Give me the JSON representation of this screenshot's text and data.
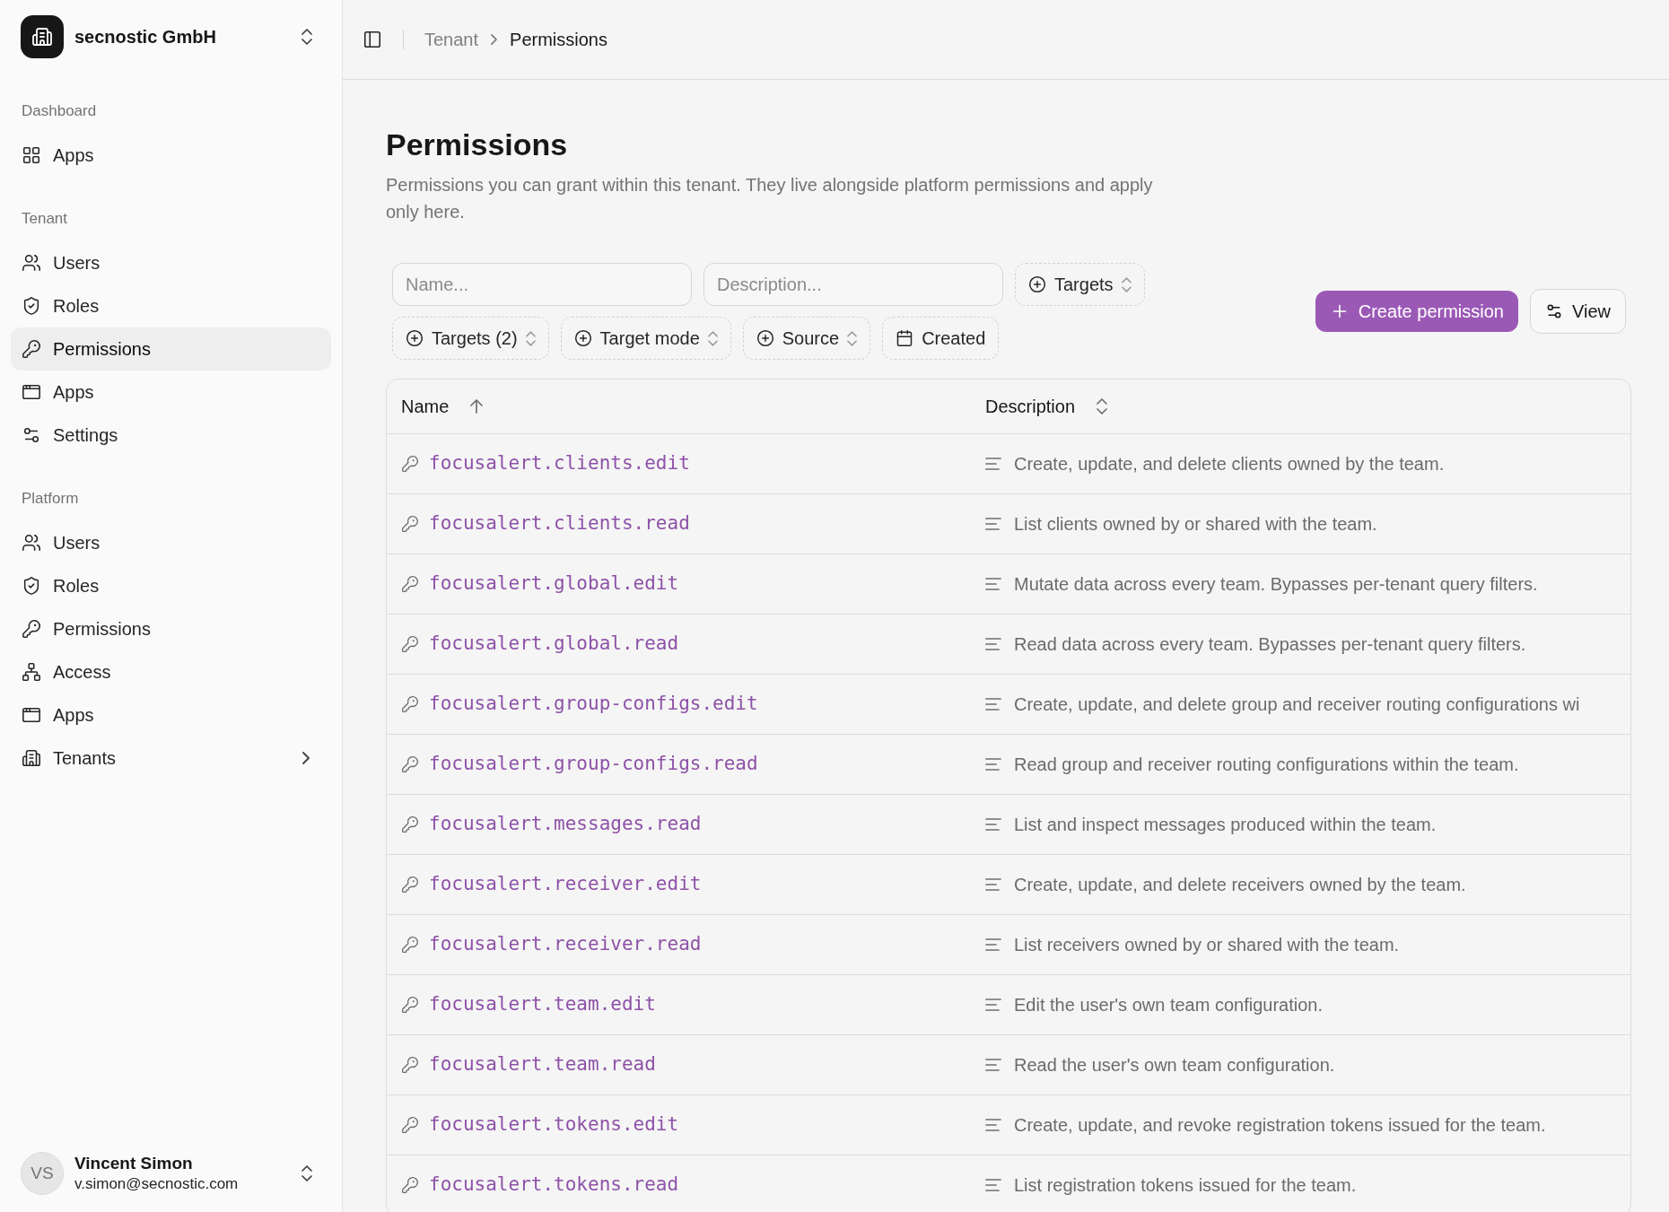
{
  "sidebar": {
    "team": {
      "name": "secnostic GmbH"
    },
    "groups": [
      {
        "label": "Dashboard",
        "items": [
          {
            "label": "Apps",
            "selected": false
          }
        ]
      },
      {
        "label": "Tenant",
        "items": [
          {
            "label": "Users",
            "selected": false
          },
          {
            "label": "Roles",
            "selected": false
          },
          {
            "label": "Permissions",
            "selected": true
          },
          {
            "label": "Apps",
            "selected": false
          },
          {
            "label": "Settings",
            "selected": false
          }
        ]
      },
      {
        "label": "Platform",
        "items": [
          {
            "label": "Users",
            "selected": false
          },
          {
            "label": "Roles",
            "selected": false
          },
          {
            "label": "Permissions",
            "selected": false
          },
          {
            "label": "Access",
            "selected": false
          },
          {
            "label": "Apps",
            "selected": false
          },
          {
            "label": "Tenants",
            "selected": false,
            "expanded": false
          }
        ]
      }
    ],
    "user": {
      "initials": "VS",
      "name": "Vincent Simon",
      "email": "v.simon@secnostic.com"
    }
  },
  "header": {
    "breadcrumb": [
      {
        "label": "Tenant",
        "current": false
      },
      {
        "label": "Permissions",
        "current": true
      }
    ]
  },
  "page": {
    "title": "Permissions",
    "description": "Permissions you can grant within this tenant. They live alongside platform permissions and apply only here."
  },
  "filters": {
    "inputs": [
      {
        "placeholder": "Name..."
      },
      {
        "placeholder": "Description..."
      }
    ],
    "facets": [
      {
        "kind": "select",
        "label": "Targets"
      },
      {
        "kind": "select",
        "label": "Targets (2)"
      },
      {
        "kind": "select",
        "label": "Target mode"
      },
      {
        "kind": "select",
        "label": "Source"
      },
      {
        "kind": "date",
        "label": "Created"
      }
    ]
  },
  "actions": [
    {
      "kind": "primary",
      "label": "Create permission"
    },
    {
      "kind": "view",
      "label": "View"
    }
  ],
  "table": {
    "columns": [
      {
        "label": "Name",
        "sorted": true
      },
      {
        "label": "Description",
        "sorted": false
      }
    ],
    "rows": [
      {
        "name": "focusalert.clients.edit",
        "description": "Create, update, and delete clients owned by the team."
      },
      {
        "name": "focusalert.clients.read",
        "description": "List clients owned by or shared with the team."
      },
      {
        "name": "focusalert.global.edit",
        "description": "Mutate data across every team. Bypasses per-tenant query filters."
      },
      {
        "name": "focusalert.global.read",
        "description": "Read data across every team. Bypasses per-tenant query filters."
      },
      {
        "name": "focusalert.group-configs.edit",
        "description": "Create, update, and delete group and receiver routing configurations wi"
      },
      {
        "name": "focusalert.group-configs.read",
        "description": "Read group and receiver routing configurations within the team."
      },
      {
        "name": "focusalert.messages.read",
        "description": "List and inspect messages produced within the team."
      },
      {
        "name": "focusalert.receiver.edit",
        "description": "Create, update, and delete receivers owned by the team."
      },
      {
        "name": "focusalert.receiver.read",
        "description": "List receivers owned by or shared with the team."
      },
      {
        "name": "focusalert.team.edit",
        "description": "Edit the user's own team configuration."
      },
      {
        "name": "focusalert.team.read",
        "description": "Read the user's own team configuration."
      },
      {
        "name": "focusalert.tokens.edit",
        "description": "Create, update, and revoke registration tokens issued for the team."
      },
      {
        "name": "focusalert.tokens.read",
        "description": "List registration tokens issued for the team."
      }
    ]
  }
}
